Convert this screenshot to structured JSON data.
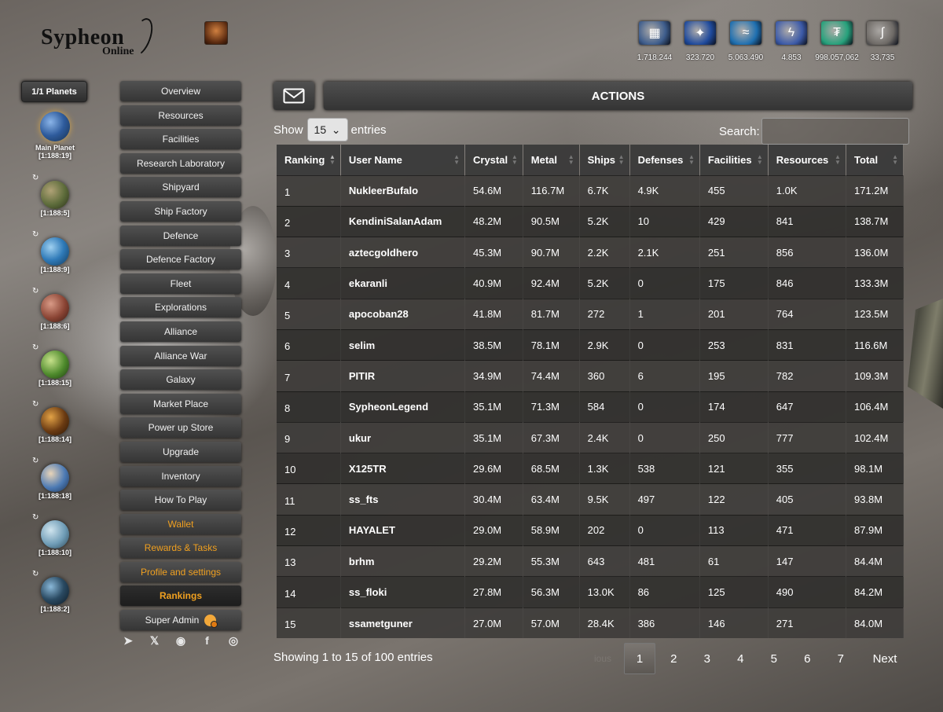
{
  "logo": {
    "main": "Sypheon",
    "sub": "Online"
  },
  "resources": [
    {
      "icon": "crystal-icon",
      "glyph": "▦",
      "color": "#3e5d8c",
      "value": "1.718.244"
    },
    {
      "icon": "metal-icon",
      "glyph": "✦",
      "color": "#1f4a9c",
      "value": "323.720"
    },
    {
      "icon": "deuterium-icon",
      "glyph": "≈",
      "color": "#1e6fb0",
      "value": "5.063.490"
    },
    {
      "icon": "energy-icon",
      "glyph": "ϟ",
      "color": "#3c5aa8",
      "value": "4.853"
    },
    {
      "icon": "tether-icon",
      "glyph": "₮",
      "color": "#26a17b",
      "value": "998.057,062"
    },
    {
      "icon": "sypheon-token-icon",
      "glyph": "∫",
      "color": "#6e6a66",
      "value": "33,735"
    }
  ],
  "planets": {
    "button_label": "1/1 Planets",
    "items": [
      {
        "name": "Main Planet",
        "coord": "[1:188:19]",
        "color": "radial-gradient(circle at 35% 35%, #8ab4e8, #2e5b9c 50%, #17304f)"
      },
      {
        "name": "",
        "coord": "[1:188:5]",
        "color": "radial-gradient(circle at 35% 35%, #b0a276, #5c6b3a 55%, #2a2e18)"
      },
      {
        "name": "",
        "coord": "[1:188:9]",
        "color": "radial-gradient(circle at 35% 35%, #9fd0f0, #2f7ab8 50%, #123a5c)"
      },
      {
        "name": "",
        "coord": "[1:188:6]",
        "color": "radial-gradient(circle at 35% 35%, #d89a86, #8a4434 55%, #3a1a12)"
      },
      {
        "name": "",
        "coord": "[1:188:15]",
        "color": "radial-gradient(circle at 35% 35%, #c6e08a, #4e8a2c 55%, #1c3a10)"
      },
      {
        "name": "",
        "coord": "[1:188:14]",
        "color": "radial-gradient(circle at 35% 35%, #e2a246, #6a3a12 55%, #2a1606)"
      },
      {
        "name": "",
        "coord": "[1:188:18]",
        "color": "radial-gradient(circle at 35% 35%, #e8d4b8, #4c7ab4 55%, #1c3050)"
      },
      {
        "name": "",
        "coord": "[1:188:10]",
        "color": "radial-gradient(circle at 35% 35%, #cfe4ee, #6f9cb6 55%, #2a4656)"
      },
      {
        "name": "",
        "coord": "[1:188:2]",
        "color": "radial-gradient(circle at 35% 35%, #8ab8d8, #2a4a62 50%, #0e1a24)"
      }
    ]
  },
  "nav": [
    {
      "label": "Overview",
      "style": ""
    },
    {
      "label": "Resources",
      "style": ""
    },
    {
      "label": "Facilities",
      "style": ""
    },
    {
      "label": "Research Laboratory",
      "style": ""
    },
    {
      "label": "Shipyard",
      "style": ""
    },
    {
      "label": "Ship Factory",
      "style": ""
    },
    {
      "label": "Defence",
      "style": ""
    },
    {
      "label": "Defence Factory",
      "style": ""
    },
    {
      "label": "Fleet",
      "style": ""
    },
    {
      "label": "Explorations",
      "style": ""
    },
    {
      "label": "Alliance",
      "style": ""
    },
    {
      "label": "Alliance War",
      "style": ""
    },
    {
      "label": "Galaxy",
      "style": ""
    },
    {
      "label": "Market Place",
      "style": ""
    },
    {
      "label": "Power up Store",
      "style": ""
    },
    {
      "label": "Upgrade",
      "style": ""
    },
    {
      "label": "Inventory",
      "style": ""
    },
    {
      "label": "How To Play",
      "style": ""
    },
    {
      "label": "Wallet",
      "style": "gold"
    },
    {
      "label": "Rewards & Tasks",
      "style": "gold"
    },
    {
      "label": "Profile and settings",
      "style": "gold"
    },
    {
      "label": "Rankings",
      "style": "active"
    },
    {
      "label": "Super Admin",
      "style": ""
    }
  ],
  "socials": [
    {
      "name": "telegram-icon",
      "glyph": "➤"
    },
    {
      "name": "x-icon",
      "glyph": "𝕏"
    },
    {
      "name": "discord-icon",
      "glyph": "◉"
    },
    {
      "name": "facebook-icon",
      "glyph": "f"
    },
    {
      "name": "instagram-icon",
      "glyph": "◎"
    }
  ],
  "header": {
    "title": "ACTIONS"
  },
  "controls": {
    "show_label": "Show",
    "page_size": "15",
    "entries_label": "entries",
    "search_label": "Search:",
    "search_value": ""
  },
  "table": {
    "columns": [
      "Ranking",
      "User Name",
      "Crystal",
      "Metal",
      "Ships",
      "Defenses",
      "Facilities",
      "Resources",
      "Total"
    ],
    "rows": [
      [
        "1",
        "NukleerBufalo",
        "54.6M",
        "116.7M",
        "6.7K",
        "4.9K",
        "455",
        "1.0K",
        "171.2M"
      ],
      [
        "2",
        "KendiniSalanAdam",
        "48.2M",
        "90.5M",
        "5.2K",
        "10",
        "429",
        "841",
        "138.7M"
      ],
      [
        "3",
        "aztecgoldhero",
        "45.3M",
        "90.7M",
        "2.2K",
        "2.1K",
        "251",
        "856",
        "136.0M"
      ],
      [
        "4",
        "ekaranli",
        "40.9M",
        "92.4M",
        "5.2K",
        "0",
        "175",
        "846",
        "133.3M"
      ],
      [
        "5",
        "apocoban28",
        "41.8M",
        "81.7M",
        "272",
        "1",
        "201",
        "764",
        "123.5M"
      ],
      [
        "6",
        "selim",
        "38.5M",
        "78.1M",
        "2.9K",
        "0",
        "253",
        "831",
        "116.6M"
      ],
      [
        "7",
        "PITIR",
        "34.9M",
        "74.4M",
        "360",
        "6",
        "195",
        "782",
        "109.3M"
      ],
      [
        "8",
        "SypheonLegend",
        "35.1M",
        "71.3M",
        "584",
        "0",
        "174",
        "647",
        "106.4M"
      ],
      [
        "9",
        "ukur",
        "35.1M",
        "67.3M",
        "2.4K",
        "0",
        "250",
        "777",
        "102.4M"
      ],
      [
        "10",
        "X125TR",
        "29.6M",
        "68.5M",
        "1.3K",
        "538",
        "121",
        "355",
        "98.1M"
      ],
      [
        "11",
        "ss_fts",
        "30.4M",
        "63.4M",
        "9.5K",
        "497",
        "122",
        "405",
        "93.8M"
      ],
      [
        "12",
        "HAYALET",
        "29.0M",
        "58.9M",
        "202",
        "0",
        "113",
        "471",
        "87.9M"
      ],
      [
        "13",
        "brhm",
        "29.2M",
        "55.3M",
        "643",
        "481",
        "61",
        "147",
        "84.4M"
      ],
      [
        "14",
        "ss_floki",
        "27.8M",
        "56.3M",
        "13.0K",
        "86",
        "125",
        "490",
        "84.2M"
      ],
      [
        "15",
        "ssametguner",
        "27.0M",
        "57.0M",
        "28.4K",
        "386",
        "146",
        "271",
        "84.0M"
      ]
    ]
  },
  "footer": {
    "info": "Showing 1 to 15 of 100 entries",
    "prev_label": "ious",
    "pages": [
      "1",
      "2",
      "3",
      "4",
      "5",
      "6",
      "7"
    ],
    "current_page": "1",
    "next_label": "Next"
  }
}
